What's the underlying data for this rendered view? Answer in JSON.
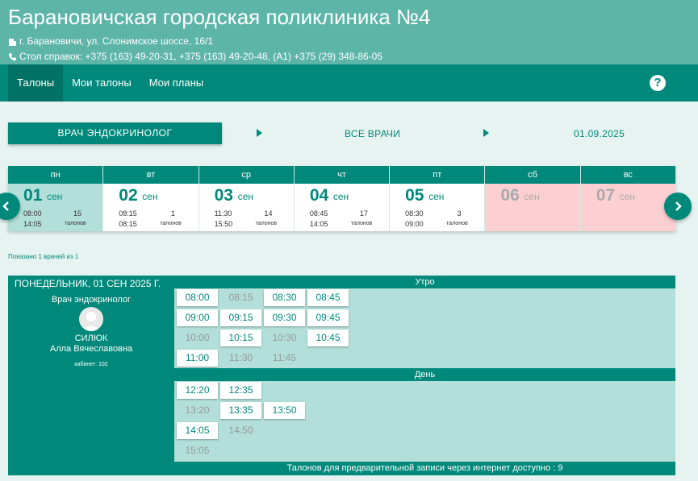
{
  "header": {
    "title": "Барановичская городская поликлиника №4",
    "address": "г. Барановичи, ул. Слонимское шоссе, 16/1",
    "phones": "Стол справок: +375 (163) 49-20-31, +375 (163) 49-20-48, (A1) +375 (29) 348-86-05"
  },
  "nav": {
    "tabs": [
      "Талоны",
      "Мои талоны",
      "Мои планы"
    ],
    "help_label": "?"
  },
  "filters": {
    "specialty": "ВРАЧ ЭНДОКРИНОЛОГ",
    "doctors": "ВСЕ ВРАЧИ",
    "date": "01.09.2025"
  },
  "week": {
    "days": [
      {
        "dow": "пн",
        "num": "01",
        "month": "сен",
        "time_from": "08:00",
        "time_to": "14:05",
        "count": "15",
        "count_label": "талонов"
      },
      {
        "dow": "вт",
        "num": "02",
        "month": "сен",
        "time_from": "08:15",
        "time_to": "08:15",
        "count": "1",
        "count_label": "талонов"
      },
      {
        "dow": "ср",
        "num": "03",
        "month": "сен",
        "time_from": "11:30",
        "time_to": "15:50",
        "count": "14",
        "count_label": "талонов"
      },
      {
        "dow": "чт",
        "num": "04",
        "month": "сен",
        "time_from": "08:45",
        "time_to": "14:05",
        "count": "17",
        "count_label": "талонов"
      },
      {
        "dow": "пт",
        "num": "05",
        "month": "сен",
        "time_from": "08:30",
        "time_to": "09:00",
        "count": "3",
        "count_label": "талонов"
      },
      {
        "dow": "сб",
        "num": "06",
        "month": "сен"
      },
      {
        "dow": "вс",
        "num": "07",
        "month": "сен"
      }
    ]
  },
  "shown_text": "Показано 1 врачей из 1",
  "schedule": {
    "date_title": "ПОНЕДЕЛЬНИК, 01 СЕН 2025 Г.",
    "doctor": {
      "specialty": "Врач эндокринолог",
      "surname": "СИЛЮК",
      "name": "Алла Вячеславовна",
      "cabinet": "кабинет: 102"
    },
    "morning_title": "Утро",
    "morning_slots": [
      {
        "time": "08:00",
        "free": true
      },
      {
        "time": "08:15",
        "free": false
      },
      {
        "time": "08:30",
        "free": true
      },
      {
        "time": "08:45",
        "free": true
      },
      {
        "time": "09:00",
        "free": true
      },
      {
        "time": "09:15",
        "free": true
      },
      {
        "time": "09:30",
        "free": true
      },
      {
        "time": "09:45",
        "free": true
      },
      {
        "time": "10:00",
        "free": false
      },
      {
        "time": "10:15",
        "free": true
      },
      {
        "time": "10:30",
        "free": false
      },
      {
        "time": "10:45",
        "free": true
      },
      {
        "time": "11:00",
        "free": true
      },
      {
        "time": "11:30",
        "free": false
      },
      {
        "time": "11:45",
        "free": false
      }
    ],
    "day_title": "День",
    "day_slots": [
      {
        "time": "12:20",
        "free": true
      },
      {
        "time": "12:35",
        "free": true
      },
      {
        "time": "13:20",
        "free": false
      },
      {
        "time": "13:35",
        "free": true
      },
      {
        "time": "13:50",
        "free": true
      },
      {
        "time": "14:05",
        "free": true
      },
      {
        "time": "14:50",
        "free": false
      },
      {
        "time": "15:05",
        "free": false
      }
    ],
    "footer": "Талонов для предварительной записи через интернет доступно : 9"
  }
}
